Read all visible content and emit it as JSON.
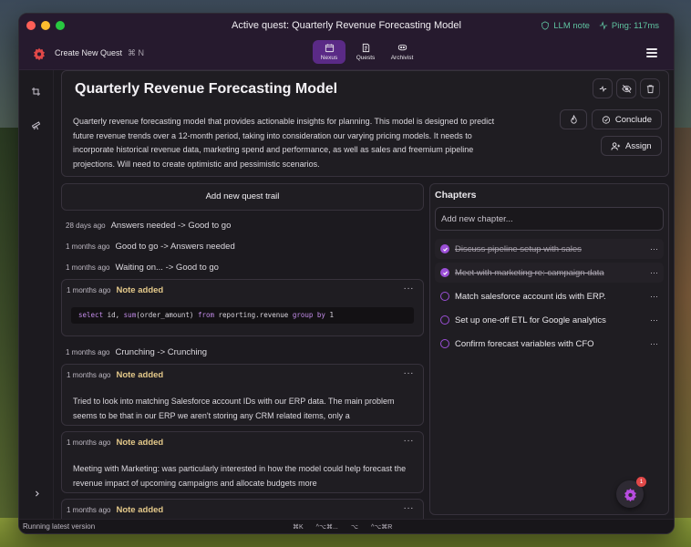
{
  "titlebar": {
    "active_quest_label": "Active quest:",
    "active_quest_title": "Quarterly Revenue Forecasting Model",
    "llm_note": "LLM note",
    "ping": "Ping: 117ms"
  },
  "toolbar": {
    "create_quest": "Create New Quest",
    "create_quest_shortcut": "⌘ N",
    "nav": [
      {
        "label": "Nexus",
        "icon": "calendar-icon",
        "active": true
      },
      {
        "label": "Quests",
        "icon": "quests-icon",
        "active": false
      },
      {
        "label": "Archivist",
        "icon": "archivist-icon",
        "active": false
      }
    ]
  },
  "quest": {
    "title": "Quarterly Revenue Forecasting Model",
    "description": "Quarterly revenue forecasting model that provides actionable insights for planning. This model is designed to predict future revenue trends over a 12-month period, taking into consideration our varying pricing models. It needs to incorporate historical revenue data, marketing spend and performance, as well as sales and freemium pipeline projections. Will need to create optimistic and pessimistic scenarios.",
    "conclude_label": "Conclude",
    "assign_label": "Assign"
  },
  "trail": {
    "add_label": "Add new quest trail",
    "events": [
      {
        "ts": "28 days ago",
        "text": "Answers needed -> Good to go"
      },
      {
        "ts": "1 months ago",
        "text": "Good to go -> Answers needed"
      },
      {
        "ts": "1 months ago",
        "text": "Waiting on... -> Good to go"
      }
    ],
    "note1": {
      "ts": "1 months ago",
      "label": "Note added",
      "more": "···"
    },
    "code": {
      "kw1": "select",
      "t1": " id, ",
      "kw2": "sum",
      "t2": "(order_amount) ",
      "kw3": "from",
      "t3": " reporting.revenue ",
      "kw4": "group by",
      "t4": " 1"
    },
    "event4": {
      "ts": "1 months ago",
      "text": "Crunching -> Crunching"
    },
    "note2": {
      "ts": "1 months ago",
      "label": "Note added",
      "more": "···",
      "body": "Tried to look into matching Salesforce account IDs with our ERP data. The main problem seems to be that in our ERP we aren't storing any CRM related items, only a"
    },
    "note3": {
      "ts": "1 months ago",
      "label": "Note added",
      "more": "···",
      "body": "Meeting with Marketing: was particularly interested in how the model could help forecast the revenue impact of upcoming campaigns and allocate budgets more"
    },
    "note4": {
      "ts": "1 months ago",
      "label": "Note added",
      "more": "···"
    }
  },
  "chapters": {
    "title": "Chapters",
    "placeholder": "Add new chapter...",
    "items": [
      {
        "label": "Discuss pipeline setup with sales",
        "done": true
      },
      {
        "label": "Meet with marketing re: campaign data",
        "done": true
      },
      {
        "label": "Match salesforce account ids with ERP.",
        "done": false
      },
      {
        "label": "Set up one-off ETL for Google analytics",
        "done": false
      },
      {
        "label": "Confirm forecast variables with CFO",
        "done": false
      }
    ],
    "more": "···"
  },
  "statusbar": {
    "text": "Running latest version",
    "shortcut1": "⌘K",
    "shortcut2": "^⌥⌘...",
    "shortcut3": "⌥",
    "shortcut4": "^⌥⌘R"
  },
  "fab": {
    "badge": "1"
  },
  "colors": {
    "accent": "#5a2a86",
    "check": "#9b4fd6",
    "note_label": "#e4c98a",
    "status_green": "#5fc3a0"
  }
}
